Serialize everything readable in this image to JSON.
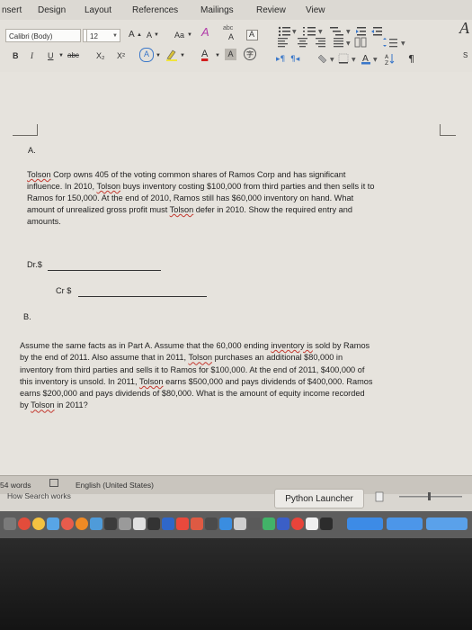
{
  "ribbon": {
    "tabs": [
      "nsert",
      "Design",
      "Layout",
      "References",
      "Mailings",
      "Review",
      "View"
    ],
    "font_name": "Calibri (Body)",
    "font_size": "12",
    "grow_font": "A",
    "shrink_font": "A",
    "clear_format": "Aa",
    "text_effects": "A",
    "phonetic": "abc",
    "char_border": "A",
    "bold": "B",
    "italic": "I",
    "underline": "U",
    "strike": "abc",
    "subscript": "X₂",
    "superscript": "X²",
    "text_effect2": "A",
    "font_color": "A",
    "char_shading": "A",
    "sort_icon": "A↓Z",
    "pilcrow": "¶"
  },
  "document": {
    "part_a_label": "A.",
    "paragraph_a": [
      "Tolson Corp owns 405 of the voting common shares of Ramos Corp and has significant",
      "influence. In 2010, Tolson buys inventory costing $100,000 from third parties and then sells it to",
      "Ramos for 150,000. At the end of 2010, Ramos still has $60,000 inventory on hand. What",
      "amount of unrealized gross profit must Tolson defer in 2010. Show the required entry and",
      "amounts."
    ],
    "dr_label": "Dr.$",
    "cr_label": "Cr $",
    "part_b_label": "B.",
    "paragraph_b": [
      "Assume the same facts as in Part A. Assume that the 60,000 ending inventory  is sold by Ramos",
      "by the end of 2011. Also assume that in 2011, Tolson purchases an additional $80,000 in",
      "inventory from third parties and sells it to Ramos for $100,000. At the end of 2011, $400,000 of",
      "this inventory is unsold. In 2011, Tolson earns $500,000 and pays dividends of $400,000. Ramos",
      "earns $200,000 and pays dividends of $80,000. What is the amount of equity income recorded",
      "by Tolson in 2011?"
    ]
  },
  "status": {
    "word_count": "54 words",
    "language": "English (United States)",
    "how_works": "How Search works",
    "popup": "Python Launcher"
  }
}
